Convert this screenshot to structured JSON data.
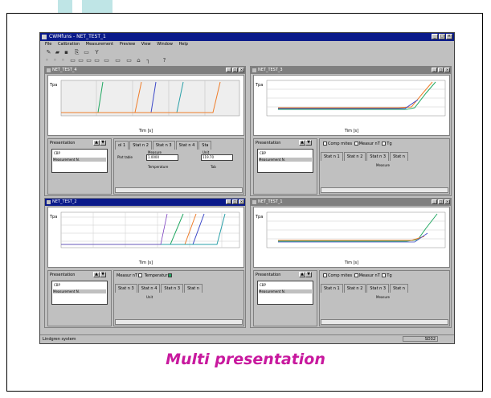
{
  "caption": "Multi presentation",
  "app": {
    "title": "CWMfuns - NET_TEST_1",
    "menu": [
      "File",
      "Calibration",
      "Measurement",
      "Preview",
      "View",
      "Window",
      "Help"
    ],
    "status_left": "Lindgren system",
    "status_right": "SD32"
  },
  "windows": [
    {
      "title": "NET_TEST_4",
      "xlabel": "Tim [s]",
      "ylabel": "Tpa",
      "ctrl": "tabs"
    },
    {
      "title": "NET_TEST_3",
      "xlabel": "Tim [s]",
      "ylabel": "Tpa",
      "ctrl": "checks"
    },
    {
      "title": "NET_TEST_2",
      "xlabel": "Tim [s]",
      "ylabel": "Tpa",
      "ctrl": "tabs2"
    },
    {
      "title": "NET_TEST_1",
      "xlabel": "Tim [s]",
      "ylabel": "Tpa",
      "ctrl": "checks"
    }
  ],
  "panel": {
    "title": "Presentation",
    "list_top": "CBP",
    "list_sel": "Measurement N."
  },
  "tabs": {
    "row": [
      "ol 1",
      "Stat n 2",
      "Stat n 3",
      "Stat n 4",
      "Sta"
    ],
    "row2": [
      "Stat n 3",
      "Stat n 4",
      "Stat n 3",
      "Stat n"
    ],
    "check_row": [
      "Comp mites",
      "Measur nT",
      "Tg"
    ],
    "check_tabs": [
      "Stat n 1",
      "Stat n 2",
      "Stat n 3",
      "Stat n"
    ],
    "top_row2": [
      "Measur nT",
      "Temperatur"
    ],
    "labels": {
      "a": "Plot table",
      "b": "Measure",
      "c": "Unit",
      "d": "Temperature",
      "e": "Tab"
    },
    "values": {
      "a": "1.0000",
      "b": "119.70"
    }
  },
  "chart_colors": {
    "green": "#22a862",
    "orange": "#ef7d2a",
    "blue": "#3c48c8",
    "purple": "#7b3fbf",
    "teal": "#2aa0a8"
  }
}
